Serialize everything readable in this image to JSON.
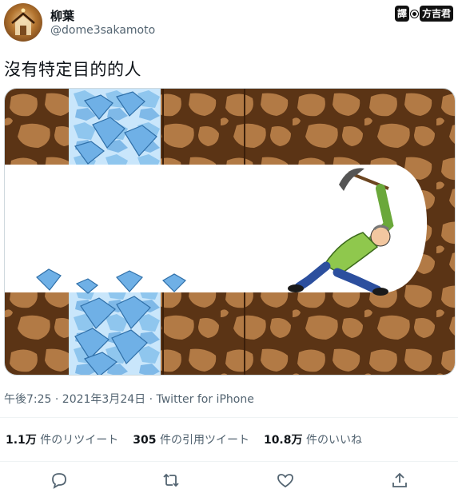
{
  "author": {
    "name": "柳葉",
    "handle": "@dome3sakamoto"
  },
  "badge": {
    "left": "譯",
    "right": "方吉君"
  },
  "tweet": {
    "text": "沒有特定目的的人"
  },
  "meta": {
    "timestamp": "午後7:25 · 2021年3月24日 · Twitter for iPhone"
  },
  "stats": {
    "retweets_count": "1.1万",
    "retweets_label": "件のリツイート",
    "quotes_count": "305",
    "quotes_label": "件の引用ツイート",
    "likes_count": "10.8万",
    "likes_label": "件のいいね"
  },
  "actions": [
    "reply-icon",
    "retweet-icon",
    "like-icon",
    "share-icon"
  ],
  "colors": {
    "dirt_dark": "#5b3415",
    "dirt_light": "#b27a45",
    "tunnel": "#ffffff",
    "diamond": "#7fb9e8",
    "text_secondary": "#536471"
  }
}
